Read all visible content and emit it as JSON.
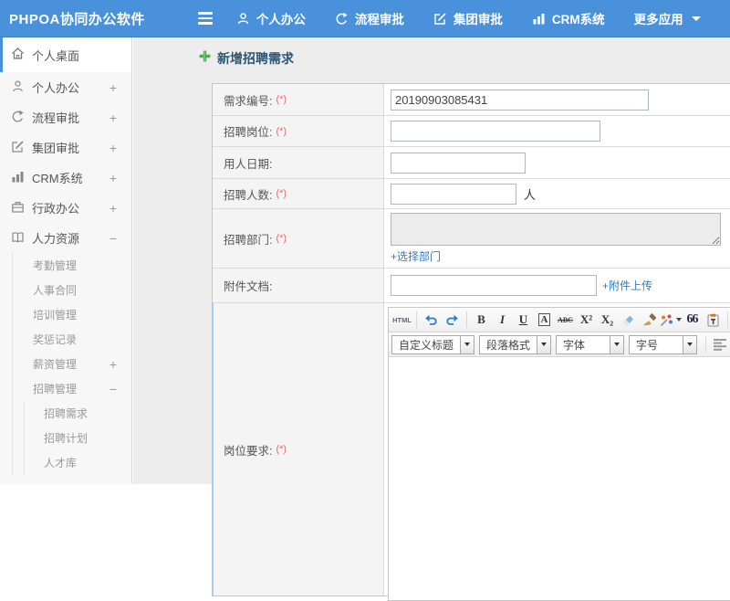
{
  "colors": {
    "accent": "#4a91db",
    "link": "#2f7dc3",
    "required": "#e96a6a",
    "plus_green": "#4fae4f"
  },
  "topbar": {
    "brand": "PHPOA协同办公软件",
    "nav": [
      {
        "label": "个人办公"
      },
      {
        "label": "流程审批"
      },
      {
        "label": "集团审批"
      },
      {
        "label": "CRM系统"
      },
      {
        "label": "更多应用"
      }
    ]
  },
  "sidebar": {
    "items": [
      {
        "label": "个人桌面",
        "expand": ""
      },
      {
        "label": "个人办公",
        "expand": "+"
      },
      {
        "label": "流程审批",
        "expand": "+"
      },
      {
        "label": "集团审批",
        "expand": "+"
      },
      {
        "label": "CRM系统",
        "expand": "+"
      },
      {
        "label": "行政办公",
        "expand": "+"
      },
      {
        "label": "人力资源",
        "expand": "−"
      }
    ],
    "hr_sub": [
      {
        "label": "考勤管理",
        "expand": ""
      },
      {
        "label": "人事合同",
        "expand": ""
      },
      {
        "label": "培训管理",
        "expand": ""
      },
      {
        "label": "奖惩记录",
        "expand": ""
      },
      {
        "label": "薪资管理",
        "expand": "+"
      },
      {
        "label": "招聘管理",
        "expand": "−"
      }
    ],
    "recruit_sub": [
      {
        "label": "招聘需求"
      },
      {
        "label": "招聘计划"
      },
      {
        "label": "人才库"
      }
    ]
  },
  "page": {
    "title": "新增招聘需求"
  },
  "form": {
    "rows": [
      {
        "label": "需求编号:",
        "required": "(*)",
        "value": "20190903085431"
      },
      {
        "label": "招聘岗位:",
        "required": "(*)"
      },
      {
        "label": "用人日期:",
        "required": ""
      },
      {
        "label": "招聘人数:",
        "required": "(*)",
        "unit": "人"
      },
      {
        "label": "招聘部门:",
        "required": "(*)",
        "link": "+选择部门"
      },
      {
        "label": "附件文档:",
        "required": "",
        "link": "+附件上传"
      },
      {
        "label": "岗位要求:",
        "required": "(*)"
      }
    ]
  },
  "editor": {
    "html_btn": "HTML",
    "bold": "B",
    "italic": "I",
    "underline": "U",
    "font_box": "A",
    "strike": "ABC",
    "superscript": "X²",
    "subscript": "X₂",
    "quote": "66",
    "font_color": "A",
    "back_color": "a",
    "selects": [
      {
        "label": "自定义标题"
      },
      {
        "label": "段落格式"
      },
      {
        "label": "字体"
      },
      {
        "label": "字号"
      }
    ]
  }
}
